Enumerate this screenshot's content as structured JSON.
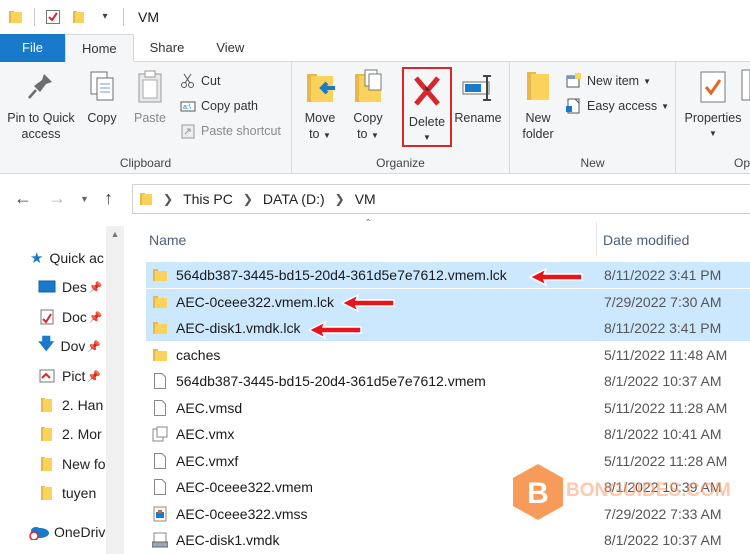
{
  "window": {
    "title": "VM"
  },
  "tabs": [
    {
      "label": "File"
    },
    {
      "label": "Home"
    },
    {
      "label": "Share"
    },
    {
      "label": "View"
    }
  ],
  "ribbon": {
    "clipboard": {
      "label": "Clipboard",
      "pin_line1": "Pin to Quick",
      "pin_line2": "access",
      "copy": "Copy",
      "paste": "Paste",
      "cut": "Cut",
      "copy_path": "Copy path",
      "paste_shortcut": "Paste shortcut"
    },
    "organize": {
      "label": "Organize",
      "move_to_line1": "Move",
      "move_to_line2": "to",
      "copy_to_line1": "Copy",
      "copy_to_line2": "to",
      "delete": "Delete",
      "rename": "Rename"
    },
    "new": {
      "label": "New",
      "new_folder_line1": "New",
      "new_folder_line2": "folder",
      "new_item": "New item",
      "easy_access": "Easy access"
    },
    "open": {
      "label": "Op",
      "properties": "Properties"
    }
  },
  "address": {
    "crumbs": [
      "This PC",
      "DATA (D:)",
      "VM"
    ]
  },
  "navpane": {
    "items": [
      {
        "label": "Quick ac",
        "icon": "star-icon"
      },
      {
        "label": "Des",
        "icon": "desktop-icon"
      },
      {
        "label": "Doc",
        "icon": "documents-icon"
      },
      {
        "label": "Dov",
        "icon": "download-icon"
      },
      {
        "label": "Pict",
        "icon": "pictures-icon"
      },
      {
        "label": "2. Han",
        "icon": "folder-icon"
      },
      {
        "label": "2. Mor",
        "icon": "folder-icon"
      },
      {
        "label": "New fo",
        "icon": "folder-icon"
      },
      {
        "label": "tuyen",
        "icon": "folder-icon"
      },
      {
        "label": "OneDriv",
        "icon": "onedrive-icon"
      }
    ]
  },
  "filelist": {
    "col_name": "Name",
    "col_date": "Date modified",
    "rows": [
      {
        "name": "564db387-3445-bd15-20d4-361d5e7e7612.vmem.lck",
        "date": "8/11/2022 3:41 PM",
        "type": "folder"
      },
      {
        "name": "AEC-0ceee322.vmem.lck",
        "date": "7/29/2022 7:30 AM",
        "type": "folder"
      },
      {
        "name": "AEC-disk1.vmdk.lck",
        "date": "8/11/2022 3:41 PM",
        "type": "folder"
      },
      {
        "name": "caches",
        "date": "5/11/2022 11:48 AM",
        "type": "folder"
      },
      {
        "name": "564db387-3445-bd15-20d4-361d5e7e7612.vmem",
        "date": "8/1/2022 10:37 AM",
        "type": "doc"
      },
      {
        "name": "AEC.vmsd",
        "date": "5/11/2022 11:28 AM",
        "type": "doc"
      },
      {
        "name": "AEC.vmx",
        "date": "8/1/2022 10:41 AM",
        "type": "vmx"
      },
      {
        "name": "AEC.vmxf",
        "date": "5/11/2022 11:28 AM",
        "type": "doc"
      },
      {
        "name": "AEC-0ceee322.vmem",
        "date": "8/1/2022 10:39 AM",
        "type": "doc"
      },
      {
        "name": "AEC-0ceee322.vmss",
        "date": "7/29/2022 7:33 AM",
        "type": "vmss"
      },
      {
        "name": "AEC-disk1.vmdk",
        "date": "8/1/2022 10:37 AM",
        "type": "vmdk"
      }
    ]
  },
  "watermark": {
    "letter": "B",
    "text": "BONGUIDES.COM"
  },
  "colors": {
    "accent": "#1979ca",
    "selection": "#cce8ff",
    "folder": "#fbd25c",
    "delete_x": "#d9262c",
    "arrow": "#e8141c",
    "watermark": "#f58a3c"
  }
}
